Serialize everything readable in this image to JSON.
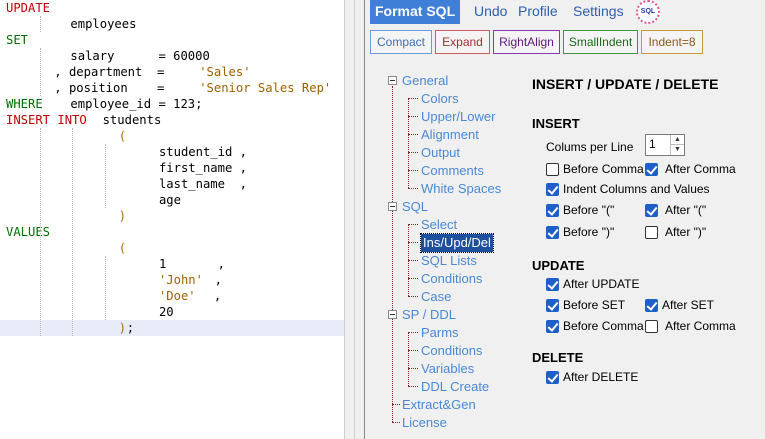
{
  "editor": {
    "lines": [
      {
        "tokens": [
          {
            "t": "UPDATE",
            "c": "kw",
            "col": 0
          }
        ]
      },
      {
        "tokens": [
          {
            "t": "employees",
            "c": "id",
            "col": 8
          }
        ]
      },
      {
        "tokens": [
          {
            "t": "SET",
            "c": "kw2",
            "col": 0
          }
        ]
      },
      {
        "tokens": [
          {
            "t": "salary      = 60000",
            "c": "id",
            "col": 8
          }
        ]
      },
      {
        "tokens": [
          {
            "t": ", department  = ",
            "c": "id",
            "col": 6
          },
          {
            "t": "'Sales'",
            "c": "str",
            "col": 24
          }
        ]
      },
      {
        "tokens": [
          {
            "t": ", position    = ",
            "c": "id",
            "col": 6
          },
          {
            "t": "'Senior Sales Rep'",
            "c": "str",
            "col": 24
          }
        ]
      },
      {
        "tokens": [
          {
            "t": "WHERE",
            "c": "kw2",
            "col": 0
          },
          {
            "t": "employee_id = 123;",
            "c": "id",
            "col": 8
          }
        ]
      },
      {
        "tokens": [
          {
            "t": "INSERT INTO",
            "c": "kw",
            "col": 0
          },
          {
            "t": "students",
            "c": "id",
            "col": 12
          }
        ]
      },
      {
        "tokens": [
          {
            "t": "(",
            "c": "par",
            "col": 14
          }
        ]
      },
      {
        "tokens": [
          {
            "t": "student_id ,",
            "c": "id",
            "col": 19
          }
        ]
      },
      {
        "tokens": [
          {
            "t": "first_name ,",
            "c": "id",
            "col": 19
          }
        ]
      },
      {
        "tokens": [
          {
            "t": "last_name  ,",
            "c": "id",
            "col": 19
          }
        ]
      },
      {
        "tokens": [
          {
            "t": "age",
            "c": "id",
            "col": 19
          }
        ]
      },
      {
        "tokens": [
          {
            "t": ")",
            "c": "par",
            "col": 14
          }
        ]
      },
      {
        "tokens": [
          {
            "t": "VALUES",
            "c": "kw2",
            "col": 0
          }
        ]
      },
      {
        "tokens": [
          {
            "t": "(",
            "c": "par",
            "col": 14
          }
        ]
      },
      {
        "tokens": [
          {
            "t": "1       ,",
            "c": "id",
            "col": 19
          }
        ]
      },
      {
        "tokens": [
          {
            "t": "'John'",
            "c": "str",
            "col": 19
          },
          {
            "t": " ,",
            "c": "id",
            "col": 25
          }
        ]
      },
      {
        "tokens": [
          {
            "t": "'Doe'",
            "c": "str",
            "col": 19
          },
          {
            "t": "  ,",
            "c": "id",
            "col": 24
          }
        ]
      },
      {
        "tokens": [
          {
            "t": "20",
            "c": "id",
            "col": 19
          }
        ]
      },
      {
        "tokens": [
          {
            "t": ")",
            "c": "par",
            "col": 14
          },
          {
            "t": ";",
            "c": "id",
            "col": 15
          }
        ]
      }
    ],
    "highlight_line": 20
  },
  "menu": {
    "format_sql": "Format SQL",
    "undo": "Undo",
    "profile": "Profile",
    "settings": "Settings",
    "logo": "SQL"
  },
  "toolbar": {
    "compact": "Compact",
    "expand": "Expand",
    "right_align": "RightAlign",
    "small_indent": "SmallIndent",
    "indent": "Indent=8"
  },
  "tree": {
    "general": "General",
    "general_children": [
      "Colors",
      "Upper/Lower",
      "Alignment",
      "Output",
      "Comments",
      "White Spaces"
    ],
    "sql": "SQL",
    "sql_children": [
      "Select",
      "Ins/Upd/Del",
      "SQL Lists",
      "Conditions",
      "Case"
    ],
    "sp_ddl": "SP / DDL",
    "sp_children": [
      "Parms",
      "Conditions",
      "Variables",
      "DDL Create"
    ],
    "extract": "Extract&Gen",
    "license": "License"
  },
  "settings": {
    "title": "INSERT / UPDATE / DELETE",
    "insert": {
      "heading": "INSERT",
      "columns_label": "Colums per Line",
      "columns_value": "1",
      "before_comma": "Before Comma",
      "after_comma": "After Comma",
      "indent_cols": "Indent Columns and Values",
      "before_open": "Before \"(\"",
      "after_open": "After \"(\"",
      "before_close": "Before \")\"",
      "after_close": "After \")\""
    },
    "update": {
      "heading": "UPDATE",
      "after_update": "After UPDATE",
      "before_set": "Before SET",
      "after_set": "After SET",
      "before_comma": "Before Comma",
      "after_comma": "After Comma"
    },
    "delete": {
      "heading": "DELETE",
      "after_delete": "After DELETE"
    }
  },
  "colors": {
    "accent": "#3f7fd8",
    "keyword": "#c00000",
    "keyword2": "#007000",
    "string": "#a06000",
    "tree_link": "#4a88d6",
    "checkbox": "#1f5fc9"
  }
}
